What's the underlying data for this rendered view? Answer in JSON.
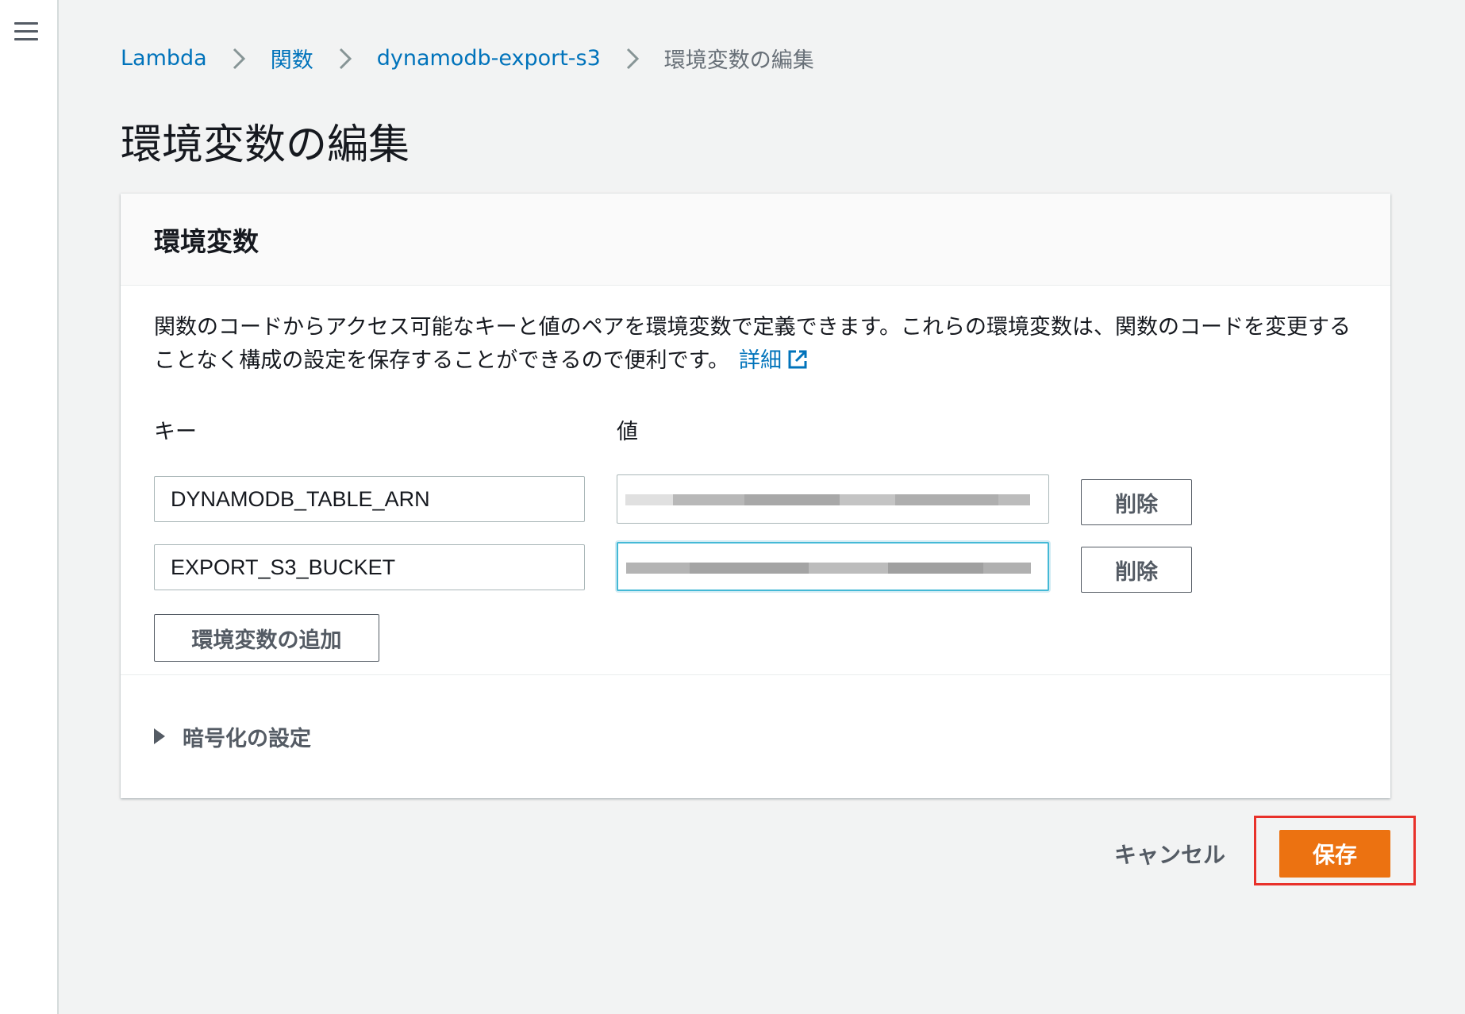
{
  "breadcrumb": {
    "items": [
      "Lambda",
      "関数",
      "dynamodb-export-s3"
    ],
    "current": "環境変数の編集"
  },
  "page_title": "環境変数の編集",
  "panel": {
    "title": "環境変数",
    "description": "関数のコードからアクセス可能なキーと値のペアを環境変数で定義できます。これらの環境変数は、関数のコードを変更することなく構成の設定を保存することができるので便利です。",
    "learn_more": "詳細",
    "key_label": "キー",
    "value_label": "値",
    "rows": [
      {
        "key": "DYNAMODB_TABLE_ARN",
        "value_redacted": true,
        "remove_label": "削除"
      },
      {
        "key": "EXPORT_S3_BUCKET",
        "value_redacted": true,
        "remove_label": "削除"
      }
    ],
    "add_label": "環境変数の追加",
    "encryption_label": "暗号化の設定"
  },
  "actions": {
    "cancel_label": "キャンセル",
    "save_label": "保存"
  },
  "colors": {
    "link": "#0073bb",
    "primary_button": "#ec7211",
    "highlight_box": "#e8312a",
    "focus_border": "#44b9d6"
  }
}
